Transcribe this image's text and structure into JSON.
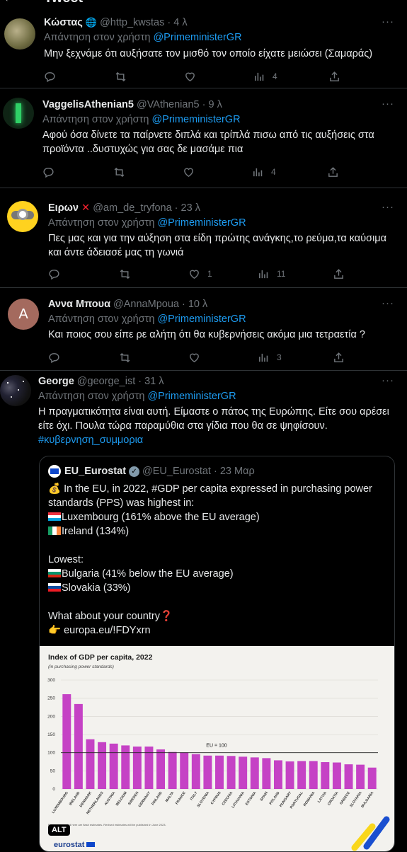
{
  "header": {
    "title": "Tweet"
  },
  "colors": {
    "link": "#1d9bf0",
    "muted": "#71767b",
    "bar": "#c542c5"
  },
  "tweets": [
    {
      "name": "Κώστας",
      "handle": "@http_kwstas · 4 λ",
      "reply_prefix": "Απάντηση στον χρήστη",
      "mention": "@PrimeministerGR",
      "text": "Μην ξεχνάμε ότι αυξήσατε τον μισθό τον οποίο είχατε μειώσει (Σαμαράς)",
      "likes": "",
      "views": "4"
    },
    {
      "name": "VaggelisAthenian5",
      "handle": "@VAthenian5 · 9 λ",
      "reply_prefix": "Απάντηση στον χρήστη",
      "mention": "@PrimeministerGR",
      "text": "Αφού όσα δίνετε τα παίρνετε διπλά και τρίπλά πισω από τις αυξήσεις στα προϊόντα ..δυστυχώς για σας δε μασάμε πια",
      "likes": "",
      "views": "4"
    },
    {
      "name": "Ειρων",
      "handle": "@am_de_tryfona · 23 λ",
      "reply_prefix": "Απάντηση στον χρήστη",
      "mention": "@PrimeministerGR",
      "text": "Πες μας και για την αύξηση στα είδη πρώτης ανάγκης,το ρεύμα,τα καύσιμα και άντε άδειασέ μας τη γωνιά",
      "likes": "1",
      "views": "11"
    },
    {
      "name": "Αννα Μπουα",
      "handle": "@AnnaMpoua · 10 λ",
      "reply_prefix": "Απάντηση στον χρήστη",
      "mention": "@PrimeministerGR",
      "text": "Και ποιος σου είπε ρε αλήτη ότι θα κυβερνήσεις ακόμα μια τετραετία ?",
      "likes": "",
      "views": "3",
      "avatar_letter": "A"
    },
    {
      "name": "George",
      "handle": "@george_ist · 31 λ",
      "reply_prefix": "Απάντηση στον χρήστη",
      "mention": "@PrimeministerGR",
      "text": "Η πραγματικότητα είναι αυτή. Είμαστε ο πάτος της Ευρώπης. Είτε σου αρέσει είτε όχι. Πουλα τώρα παραμύθια στα γίδια που θα σε ψηφίσουν.",
      "hashtag": "#κυβερνηση_συμμορια"
    }
  ],
  "quote": {
    "name": "EU_Eurostat",
    "handle": "@EU_Eurostat · 23 Μαρ",
    "line1": "In the EU, in 2022, #GDP per capita expressed in purchasing power standards (PPS) was highest in:",
    "line2": "Luxembourg  (161% above the EU average)",
    "line3": "Ireland (134%)",
    "line4": "Lowest:",
    "line5": "Bulgaria (41% below the EU average)",
    "line6": "Slovakia (33%)",
    "line7": "What about your country",
    "line8": "europa.eu/!FDYxrn",
    "alt_badge": "ALT",
    "source": "eurostat"
  },
  "chart_data": {
    "type": "bar",
    "title": "Index of GDP per capita, 2022",
    "subtitle": "(in purchasing power standards)",
    "reference_label": "EU = 100",
    "reference_value": 100,
    "ylim": [
      0,
      300
    ],
    "yticks": [
      0,
      50,
      100,
      150,
      200,
      250,
      300
    ],
    "footnote": "Figures presented here are flash estimates. Revised estimates will be published in June 2023.",
    "categories": [
      "LUXEMBOURG",
      "IRELAND",
      "DENMARK",
      "NETHERLANDS",
      "AUSTRIA",
      "BELGIUM",
      "SWEDEN",
      "GERMANY",
      "FINLAND",
      "MALTA",
      "FRANCE",
      "ITALY",
      "SLOVENIA",
      "CYPRUS",
      "CZECHIA",
      "LITHUANIA",
      "ESTONIA",
      "SPAIN",
      "POLAND",
      "HUNGARY",
      "PORTUGAL",
      "ROMANIA",
      "LATVIA",
      "CROATIA",
      "GREECE",
      "SLOVAKIA",
      "BULGARIA"
    ],
    "values": [
      261,
      234,
      137,
      129,
      125,
      120,
      117,
      117,
      109,
      102,
      101,
      96,
      92,
      92,
      91,
      89,
      87,
      85,
      79,
      76,
      77,
      77,
      74,
      73,
      68,
      67,
      59
    ]
  }
}
